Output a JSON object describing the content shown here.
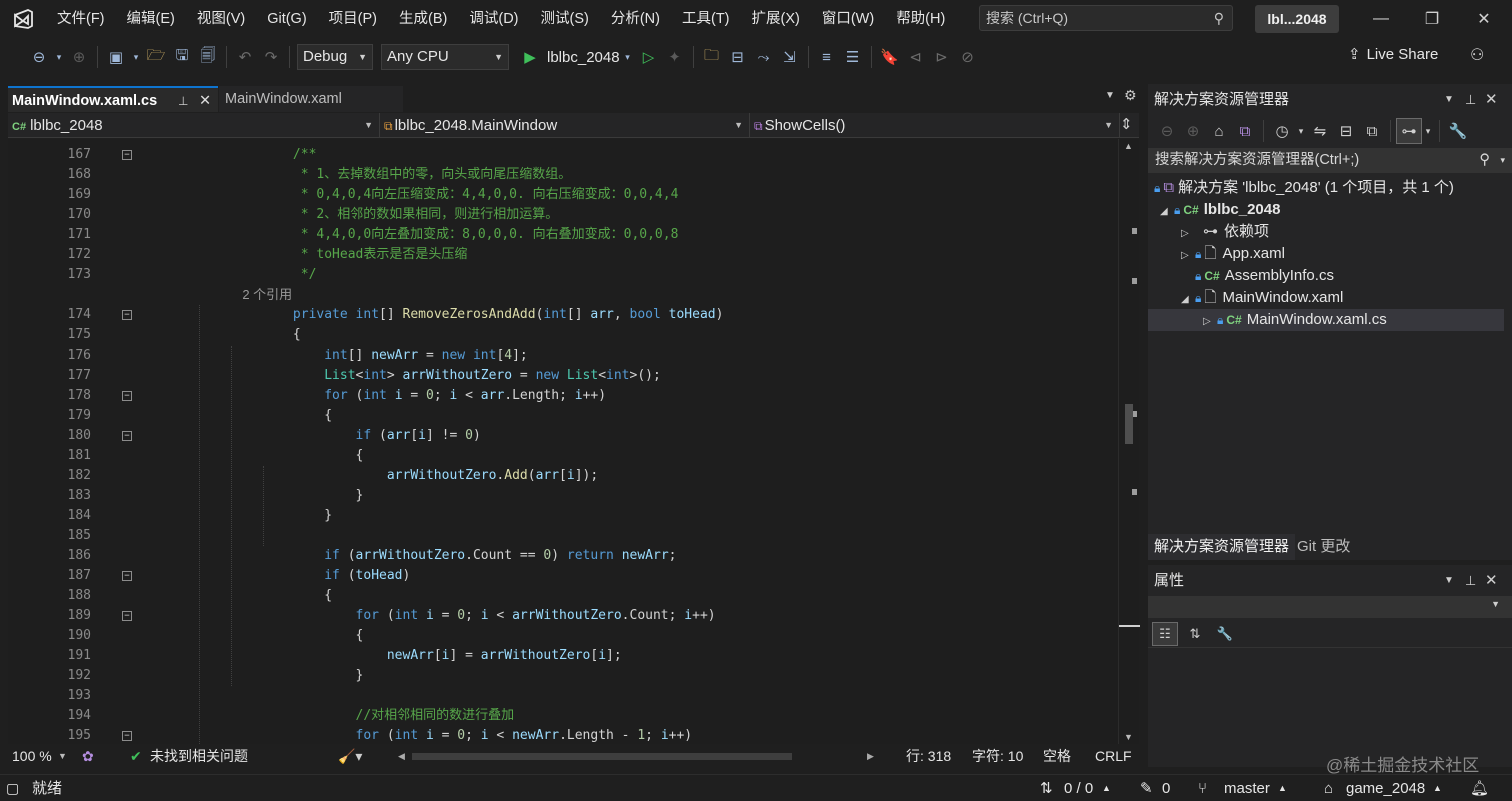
{
  "menubar": {
    "items": [
      "文件(F)",
      "编辑(E)",
      "视图(V)",
      "Git(G)",
      "项目(P)",
      "生成(B)",
      "调试(D)",
      "测试(S)",
      "分析(N)",
      "工具(T)",
      "扩展(X)",
      "窗口(W)",
      "帮助(H)"
    ],
    "search_placeholder": "搜索 (Ctrl+Q)",
    "solution_badge": "lbl...2048"
  },
  "toolbar": {
    "config": "Debug",
    "platform": "Any CPU",
    "run_target": "lblbc_2048",
    "live_share": "Live Share"
  },
  "tabs": {
    "active": "MainWindow.xaml.cs",
    "inactive": "MainWindow.xaml"
  },
  "navbar": {
    "project": "lblbc_2048",
    "class": "lblbc_2048.MainWindow",
    "member": "ShowCells()"
  },
  "editor": {
    "lines": [
      {
        "n": "167",
        "fold": true,
        "segs": [
          [
            "cm",
            "            /**"
          ]
        ]
      },
      {
        "n": "168",
        "segs": [
          [
            "cm",
            "             * 1、去掉数组中的零，向头或向尾压缩数组。"
          ]
        ]
      },
      {
        "n": "169",
        "segs": [
          [
            "cm",
            "             * 0,4,0,4向左压缩变成：4,4,0,0. 向右压缩变成：0,0,4,4"
          ]
        ]
      },
      {
        "n": "170",
        "segs": [
          [
            "cm",
            "             * 2、相邻的数如果相同，则进行相加运算。"
          ]
        ]
      },
      {
        "n": "171",
        "segs": [
          [
            "cm",
            "             * 4,4,0,0向左叠加变成：8,0,0,0. 向右叠加变成：0,0,0,8"
          ]
        ]
      },
      {
        "n": "172",
        "segs": [
          [
            "cm",
            "             * toHead表示是否是头压缩"
          ]
        ]
      },
      {
        "n": "173",
        "segs": [
          [
            "cm",
            "             */"
          ]
        ]
      },
      {
        "n": "",
        "ref": true,
        "segs": [
          [
            "ref",
            "            2 个引用"
          ]
        ]
      },
      {
        "n": "174",
        "fold": true,
        "segs": [
          [
            "kw",
            "            private "
          ],
          [
            "kw",
            "int"
          ],
          [
            "pl",
            "[] "
          ],
          [
            "fn",
            "RemoveZerosAndAdd"
          ],
          [
            "pl",
            "("
          ],
          [
            "kw",
            "int"
          ],
          [
            "pl",
            "[] "
          ],
          [
            "id",
            "arr"
          ],
          [
            "pl",
            ", "
          ],
          [
            "kw",
            "bool "
          ],
          [
            "id",
            "toHead"
          ],
          [
            "pl",
            ")"
          ]
        ]
      },
      {
        "n": "175",
        "segs": [
          [
            "pl",
            "            {"
          ]
        ]
      },
      {
        "n": "176",
        "segs": [
          [
            "kw",
            "                int"
          ],
          [
            "pl",
            "[] "
          ],
          [
            "id",
            "newArr"
          ],
          [
            "pl",
            " = "
          ],
          [
            "kw",
            "new "
          ],
          [
            "kw",
            "int"
          ],
          [
            "pl",
            "["
          ],
          [
            "nm",
            "4"
          ],
          [
            "pl",
            "];"
          ]
        ]
      },
      {
        "n": "177",
        "segs": [
          [
            "ty",
            "                List"
          ],
          [
            "pl",
            "<"
          ],
          [
            "kw",
            "int"
          ],
          [
            "pl",
            "> "
          ],
          [
            "id",
            "arrWithoutZero"
          ],
          [
            "pl",
            " = "
          ],
          [
            "kw",
            "new "
          ],
          [
            "ty",
            "List"
          ],
          [
            "pl",
            "<"
          ],
          [
            "kw",
            "int"
          ],
          [
            "pl",
            ">();"
          ]
        ]
      },
      {
        "n": "178",
        "fold": true,
        "segs": [
          [
            "kw",
            "                for "
          ],
          [
            "pl",
            "("
          ],
          [
            "kw",
            "int "
          ],
          [
            "id",
            "i"
          ],
          [
            "pl",
            " = "
          ],
          [
            "nm",
            "0"
          ],
          [
            "pl",
            "; "
          ],
          [
            "id",
            "i"
          ],
          [
            "pl",
            " < "
          ],
          [
            "id",
            "arr"
          ],
          [
            "pl",
            ".Length; "
          ],
          [
            "id",
            "i"
          ],
          [
            "pl",
            "++)"
          ]
        ]
      },
      {
        "n": "179",
        "segs": [
          [
            "pl",
            "                {"
          ]
        ]
      },
      {
        "n": "180",
        "fold": true,
        "segs": [
          [
            "kw",
            "                    if "
          ],
          [
            "pl",
            "("
          ],
          [
            "id",
            "arr"
          ],
          [
            "pl",
            "["
          ],
          [
            "id",
            "i"
          ],
          [
            "pl",
            "] != "
          ],
          [
            "nm",
            "0"
          ],
          [
            "pl",
            ")"
          ]
        ]
      },
      {
        "n": "181",
        "segs": [
          [
            "pl",
            "                    {"
          ]
        ]
      },
      {
        "n": "182",
        "segs": [
          [
            "id",
            "                        arrWithoutZero"
          ],
          [
            "pl",
            "."
          ],
          [
            "fn",
            "Add"
          ],
          [
            "pl",
            "("
          ],
          [
            "id",
            "arr"
          ],
          [
            "pl",
            "["
          ],
          [
            "id",
            "i"
          ],
          [
            "pl",
            "]);"
          ]
        ]
      },
      {
        "n": "183",
        "segs": [
          [
            "pl",
            "                    }"
          ]
        ]
      },
      {
        "n": "184",
        "segs": [
          [
            "pl",
            "                }"
          ]
        ]
      },
      {
        "n": "185",
        "segs": [
          [
            "pl",
            ""
          ]
        ]
      },
      {
        "n": "186",
        "segs": [
          [
            "kw",
            "                if "
          ],
          [
            "pl",
            "("
          ],
          [
            "id",
            "arrWithoutZero"
          ],
          [
            "pl",
            ".Count == "
          ],
          [
            "nm",
            "0"
          ],
          [
            "pl",
            ") "
          ],
          [
            "kw",
            "return "
          ],
          [
            "id",
            "newArr"
          ],
          [
            "pl",
            ";"
          ]
        ]
      },
      {
        "n": "187",
        "fold": true,
        "segs": [
          [
            "kw",
            "                if "
          ],
          [
            "pl",
            "("
          ],
          [
            "id",
            "toHead"
          ],
          [
            "pl",
            ")"
          ]
        ]
      },
      {
        "n": "188",
        "segs": [
          [
            "pl",
            "                {"
          ]
        ]
      },
      {
        "n": "189",
        "fold": true,
        "segs": [
          [
            "kw",
            "                    for "
          ],
          [
            "pl",
            "("
          ],
          [
            "kw",
            "int "
          ],
          [
            "id",
            "i"
          ],
          [
            "pl",
            " = "
          ],
          [
            "nm",
            "0"
          ],
          [
            "pl",
            "; "
          ],
          [
            "id",
            "i"
          ],
          [
            "pl",
            " < "
          ],
          [
            "id",
            "arrWithoutZero"
          ],
          [
            "pl",
            ".Count; "
          ],
          [
            "id",
            "i"
          ],
          [
            "pl",
            "++)"
          ]
        ]
      },
      {
        "n": "190",
        "segs": [
          [
            "pl",
            "                    {"
          ]
        ]
      },
      {
        "n": "191",
        "segs": [
          [
            "id",
            "                        newArr"
          ],
          [
            "pl",
            "["
          ],
          [
            "id",
            "i"
          ],
          [
            "pl",
            "] = "
          ],
          [
            "id",
            "arrWithoutZero"
          ],
          [
            "pl",
            "["
          ],
          [
            "id",
            "i"
          ],
          [
            "pl",
            "];"
          ]
        ]
      },
      {
        "n": "192",
        "segs": [
          [
            "pl",
            "                    }"
          ]
        ]
      },
      {
        "n": "193",
        "segs": [
          [
            "pl",
            ""
          ]
        ]
      },
      {
        "n": "194",
        "segs": [
          [
            "cm",
            "                    //对相邻相同的数进行叠加"
          ]
        ]
      },
      {
        "n": "195",
        "fold": true,
        "segs": [
          [
            "kw",
            "                    for "
          ],
          [
            "pl",
            "("
          ],
          [
            "kw",
            "int "
          ],
          [
            "id",
            "i"
          ],
          [
            "pl",
            " = "
          ],
          [
            "nm",
            "0"
          ],
          [
            "pl",
            "; "
          ],
          [
            "id",
            "i"
          ],
          [
            "pl",
            " < "
          ],
          [
            "id",
            "newArr"
          ],
          [
            "pl",
            ".Length - "
          ],
          [
            "nm",
            "1"
          ],
          [
            "pl",
            "; "
          ],
          [
            "id",
            "i"
          ],
          [
            "pl",
            "++)"
          ]
        ]
      }
    ]
  },
  "editor_status": {
    "zoom": "100 %",
    "issues": "未找到相关问题",
    "line": "行: 318",
    "col": "字符: 10",
    "spaces": "空格",
    "eol": "CRLF"
  },
  "statusbar": {
    "ready": "就绪",
    "errors": "0 / 0",
    "pending": "0",
    "branch": "master",
    "repo": "game_2048",
    "watermark": "@稀土掘金技术社区"
  },
  "solution_explorer": {
    "title": "解决方案资源管理器",
    "search": "搜索解决方案资源管理器(Ctrl+;)",
    "solution": "解决方案 'lblbc_2048' (1 个项目，共 1 个)",
    "project": "lblbc_2048",
    "dependencies": "依赖项",
    "app_xaml": "App.xaml",
    "assembly_info": "AssemblyInfo.cs",
    "main_window_xaml": "MainWindow.xaml",
    "main_window_cs": "MainWindow.xaml.cs",
    "tab_explorer": "解决方案资源管理器",
    "tab_git": "Git 更改"
  },
  "properties": {
    "title": "属性"
  },
  "colors": {
    "accent": "#0e74cf",
    "keyword": "#569cd6",
    "comment": "#57a64a",
    "type": "#4ec9b0",
    "method": "#dcdcaa",
    "identifier": "#9cdcfe"
  }
}
